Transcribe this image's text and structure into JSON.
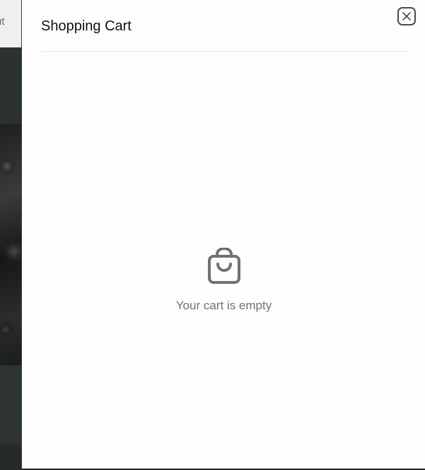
{
  "background_page": {
    "header_fragment_text": "ut"
  },
  "drawer": {
    "title": "Shopping Cart",
    "close_icon": "close-icon",
    "empty_state": {
      "icon": "shopping-bag-icon",
      "message": "Your cart is empty"
    }
  },
  "colors": {
    "drawer_background": "#fffefe",
    "title_text": "#111111",
    "empty_icon": "#74706d",
    "empty_text": "#74706d",
    "divider": "#e8e6e5",
    "overlay_background": "#2d332f"
  }
}
